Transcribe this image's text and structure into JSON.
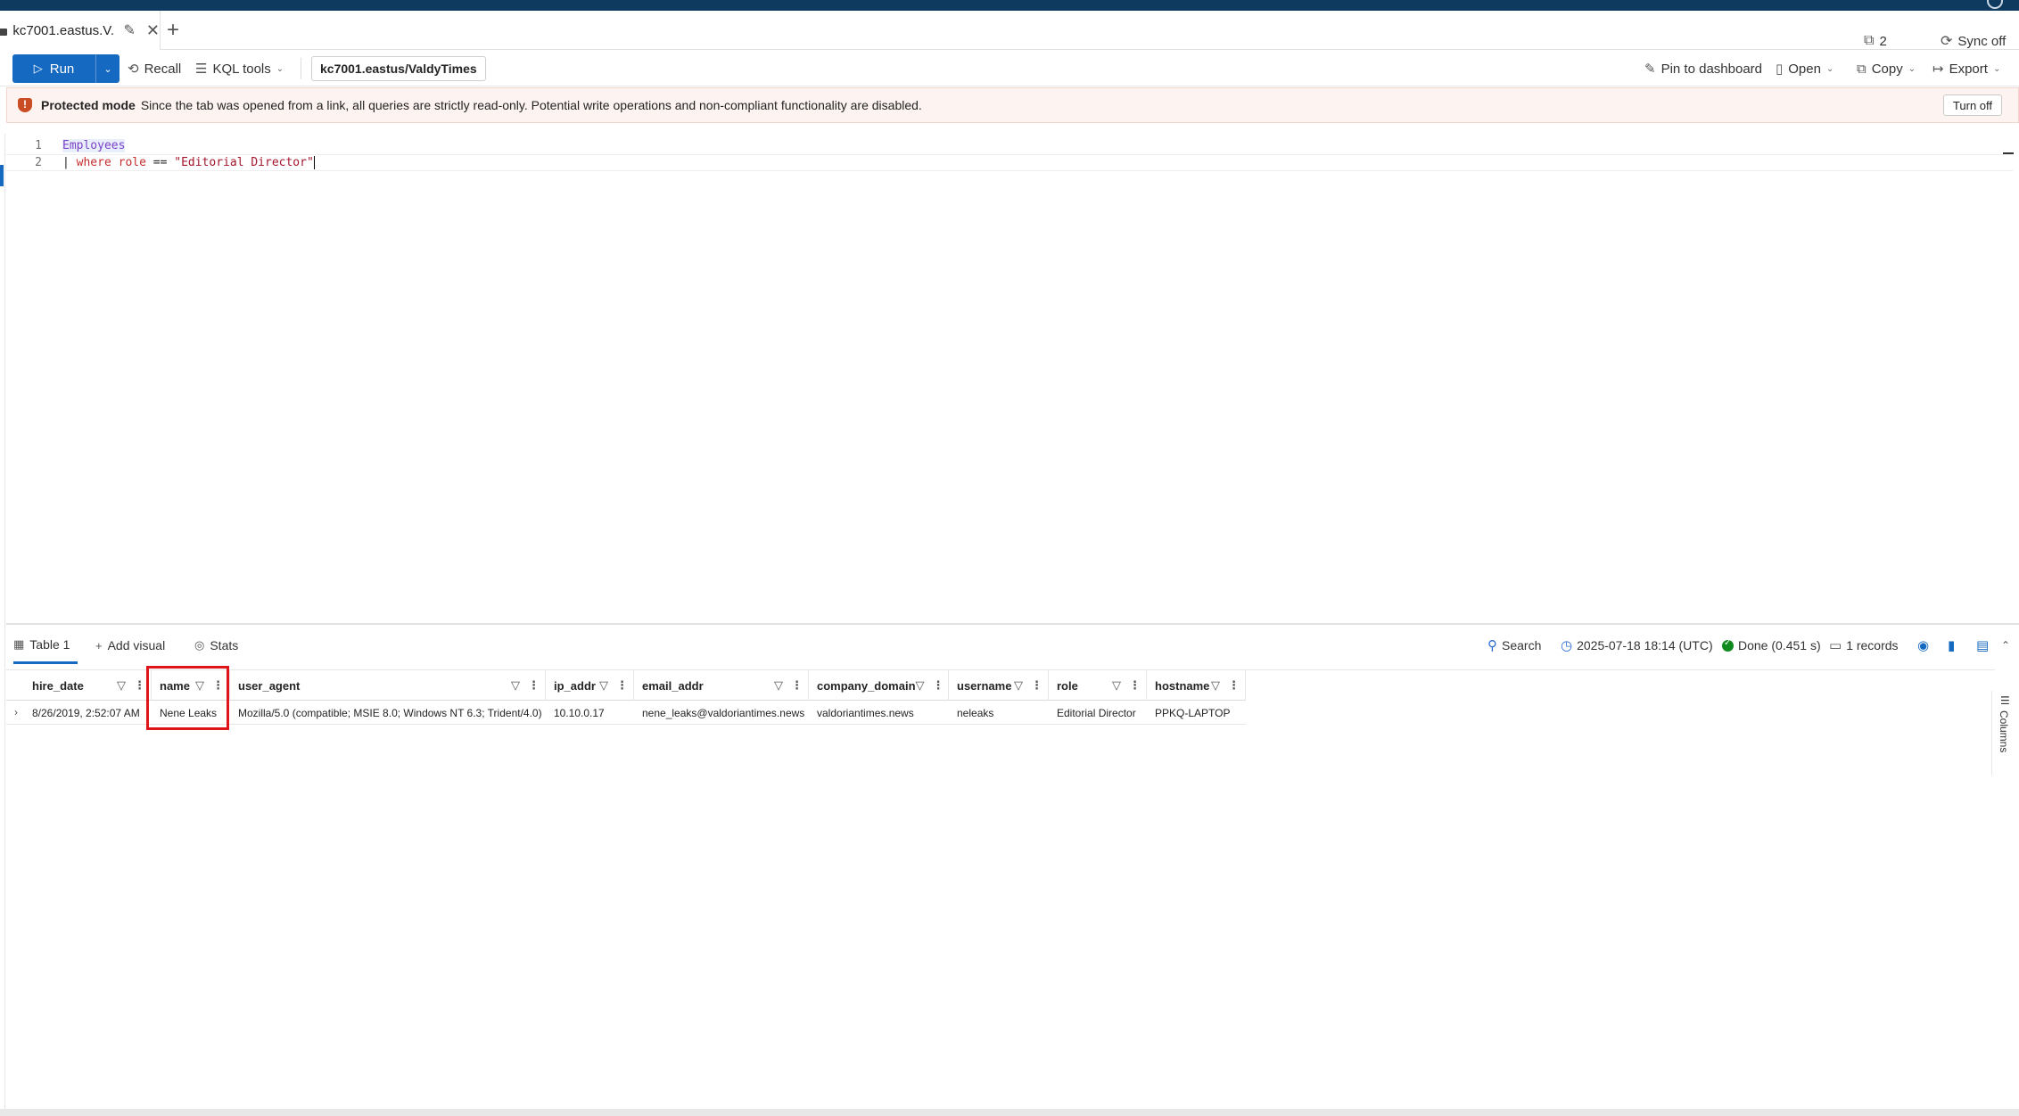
{
  "tab": {
    "label": "kc7001.eastus.V..."
  },
  "top_right": {
    "copies_count": "2",
    "sync_label": "Sync off"
  },
  "toolbar": {
    "run_label": "Run",
    "recall_label": "Recall",
    "kql_tools_label": "KQL tools",
    "cluster": "kc7001.eastus/ValdyTimes",
    "pin_label": "Pin to dashboard",
    "open_label": "Open",
    "copy_label": "Copy",
    "export_label": "Export"
  },
  "banner": {
    "title": "Protected mode",
    "message": "Since the tab was opened from a link, all queries are strictly read-only. Potential write operations and non-compliant functionality are disabled.",
    "button": "Turn off"
  },
  "editor": {
    "lines": [
      {
        "n": "1",
        "table": "Employees"
      },
      {
        "n": "2",
        "pipe": "| ",
        "kw": "where",
        "field": "role",
        "op": "==",
        "str": "\"Editorial Director\""
      }
    ]
  },
  "results": {
    "tabs": [
      "Table 1",
      "Add visual",
      "Stats"
    ],
    "search_label": "Search",
    "timestamp": "2025-07-18 18:14 (UTC)",
    "status": "Done (0.451 s)",
    "records": "1 records",
    "columns_label": "Columns",
    "headers": [
      "hire_date",
      "name",
      "user_agent",
      "ip_addr",
      "email_addr",
      "company_domain",
      "username",
      "role",
      "hostname"
    ],
    "rows": [
      [
        "8/26/2019, 2:52:07 AM",
        "Nene Leaks",
        "Mozilla/5.0 (compatible; MSIE 8.0; Windows NT 6.3; Trident/4.0)",
        "10.10.0.17",
        "nene_leaks@valdoriantimes.news",
        "valdoriantimes.news",
        "neleaks",
        "Editorial Director",
        "PPKQ-LAPTOP"
      ]
    ]
  },
  "colors": {
    "accent": "#1669c0",
    "banner_bg": "#fdf3f0",
    "highlight": "#e0151c",
    "done": "#118a1f"
  }
}
